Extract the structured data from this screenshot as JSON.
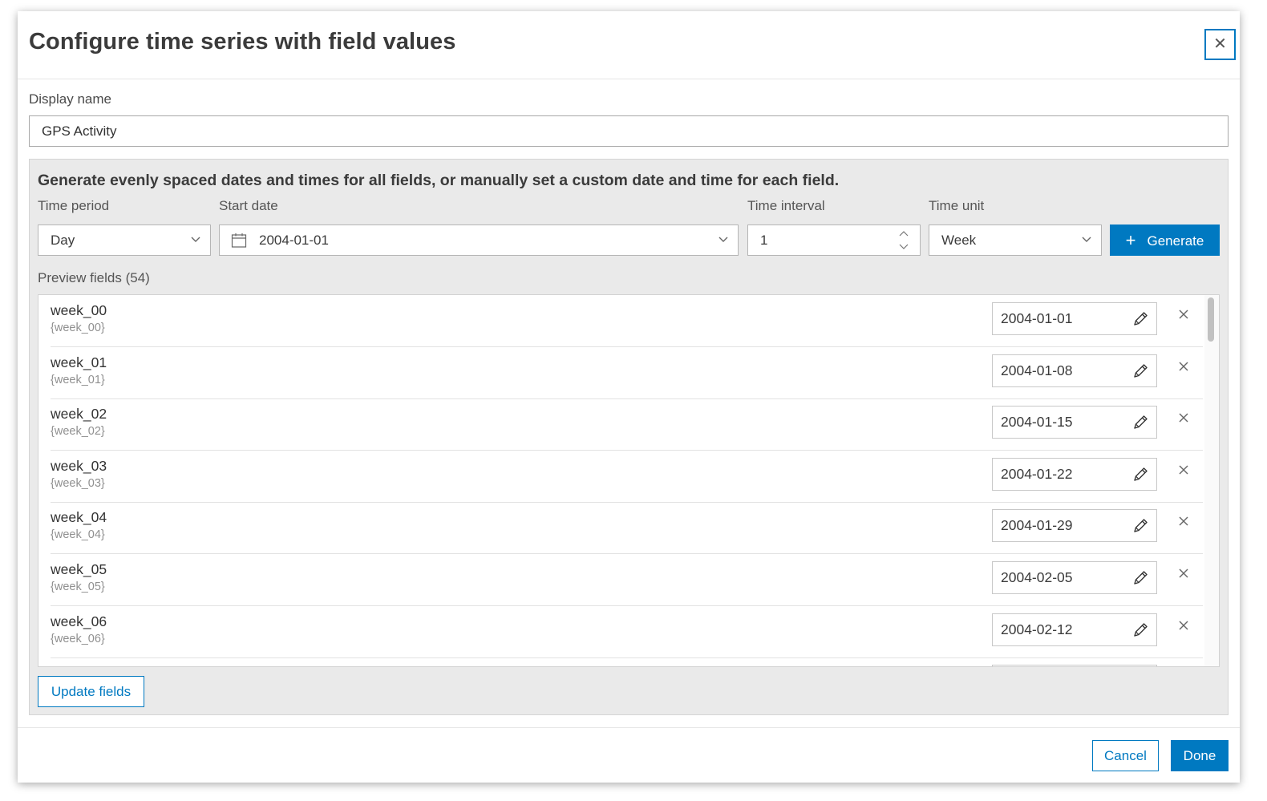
{
  "dialog": {
    "title": "Configure time series with field values",
    "close_icon": "close-icon"
  },
  "display_name": {
    "label": "Display name",
    "value": "GPS Activity"
  },
  "generator": {
    "instructions": "Generate evenly spaced dates and times for all fields, or manually set a custom date and time for each field.",
    "time_period": {
      "label": "Time period",
      "value": "Day"
    },
    "start_date": {
      "label": "Start date",
      "value": "2004-01-01",
      "icon": "calendar-icon"
    },
    "time_interval": {
      "label": "Time interval",
      "value": "1"
    },
    "time_unit": {
      "label": "Time unit",
      "value": "Week"
    },
    "generate_label": "Generate",
    "generate_icon": "plus-icon"
  },
  "preview": {
    "label": "Preview fields (54)",
    "fields": [
      {
        "name": "week_00",
        "token": "{week_00}",
        "date": "2004-01-01"
      },
      {
        "name": "week_01",
        "token": "{week_01}",
        "date": "2004-01-08"
      },
      {
        "name": "week_02",
        "token": "{week_02}",
        "date": "2004-01-15"
      },
      {
        "name": "week_03",
        "token": "{week_03}",
        "date": "2004-01-22"
      },
      {
        "name": "week_04",
        "token": "{week_04}",
        "date": "2004-01-29"
      },
      {
        "name": "week_05",
        "token": "{week_05}",
        "date": "2004-02-05"
      },
      {
        "name": "week_06",
        "token": "{week_06}",
        "date": "2004-02-12"
      }
    ]
  },
  "update_label": "Update fields",
  "footer": {
    "cancel_label": "Cancel",
    "done_label": "Done"
  },
  "colors": {
    "accent": "#0079c1",
    "panel_bg": "#eaeaea"
  }
}
